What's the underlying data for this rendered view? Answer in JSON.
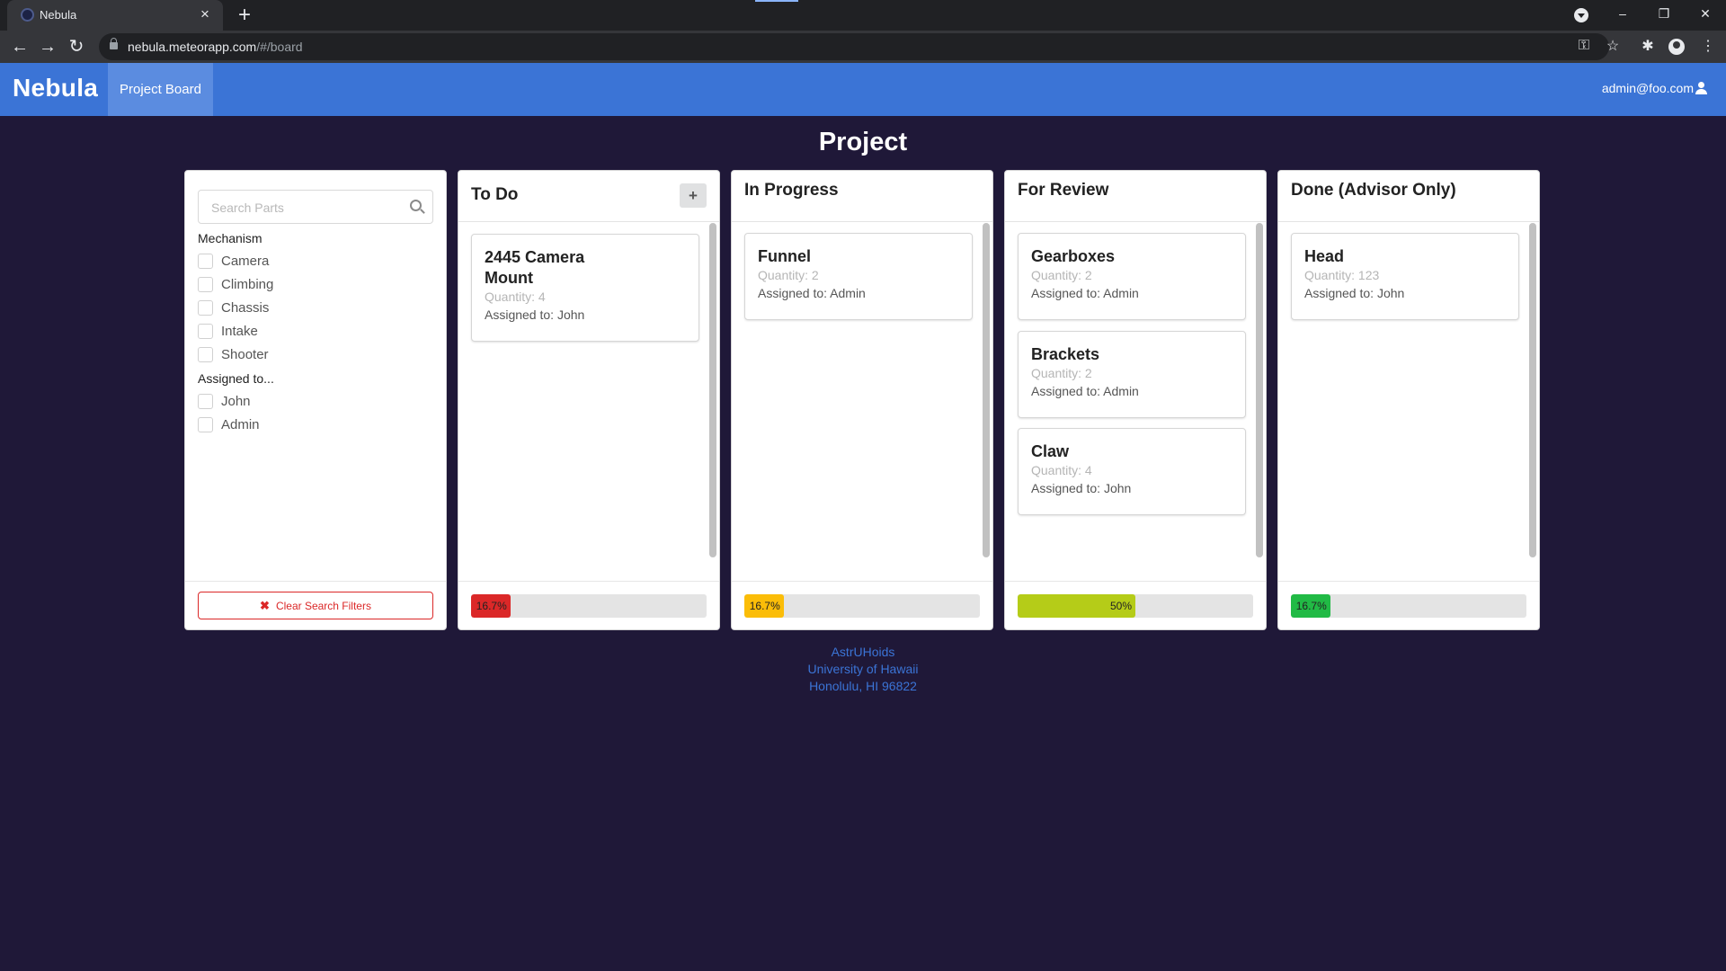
{
  "browser": {
    "tab_title": "Nebula",
    "tab_close": "×",
    "new_tab": "+",
    "url_host": "nebula.meteorapp.com",
    "url_path": "/#/board",
    "window_controls": {
      "minimize": "–",
      "restore": "❐",
      "close": "✕"
    },
    "nav": {
      "back": "←",
      "forward": "→",
      "reload": "↻"
    },
    "icons": {
      "key": "⚿",
      "star": "☆",
      "extensions": "✱",
      "menu": "⋮"
    }
  },
  "app": {
    "brand": "Nebula",
    "nav_project_board": "Project Board",
    "user_email": "admin@foo.com",
    "accent_color": "#3b74d6"
  },
  "page": {
    "title": "Project"
  },
  "filters": {
    "search_placeholder": "Search Parts",
    "mechanism_title": "Mechanism",
    "mechanisms": [
      "Camera",
      "Climbing",
      "Chassis",
      "Intake",
      "Shooter"
    ],
    "assigned_title": "Assigned to...",
    "assignees": [
      "John",
      "Admin"
    ],
    "clear_label": "Clear Search Filters",
    "clear_icon": "✖"
  },
  "columns": [
    {
      "title": "To Do",
      "add_label": "+",
      "progress_label": "16.7%",
      "progress_fraction": 0.167,
      "progress_color": "#db2828",
      "cards": [
        {
          "title": "2445 Camera Mount",
          "quantity": "Quantity: 4",
          "assigned": "Assigned to: John"
        }
      ]
    },
    {
      "title": "In Progress",
      "progress_label": "16.7%",
      "progress_fraction": 0.167,
      "progress_color": "#fbbd08",
      "cards": [
        {
          "title": "Funnel",
          "quantity": "Quantity: 2",
          "assigned": "Assigned to: Admin"
        }
      ]
    },
    {
      "title": "For Review",
      "progress_label": "50%",
      "progress_fraction": 0.5,
      "progress_color": "#b5cc18",
      "cards": [
        {
          "title": "Gearboxes",
          "quantity": "Quantity: 2",
          "assigned": "Assigned to: Admin"
        },
        {
          "title": "Brackets",
          "quantity": "Quantity: 2",
          "assigned": "Assigned to: Admin"
        },
        {
          "title": "Claw",
          "quantity": "Quantity: 4",
          "assigned": "Assigned to: John"
        }
      ]
    },
    {
      "title": "Done (Advisor Only)",
      "progress_label": "16.7%",
      "progress_fraction": 0.167,
      "progress_color": "#21ba45",
      "cards": [
        {
          "title": "Head",
          "quantity": "Quantity: 123",
          "assigned": "Assigned to: John"
        }
      ]
    }
  ],
  "footer": {
    "line1": "AstrUHoids",
    "line2": "University of Hawaii",
    "line3": "Honolulu, HI 96822"
  }
}
